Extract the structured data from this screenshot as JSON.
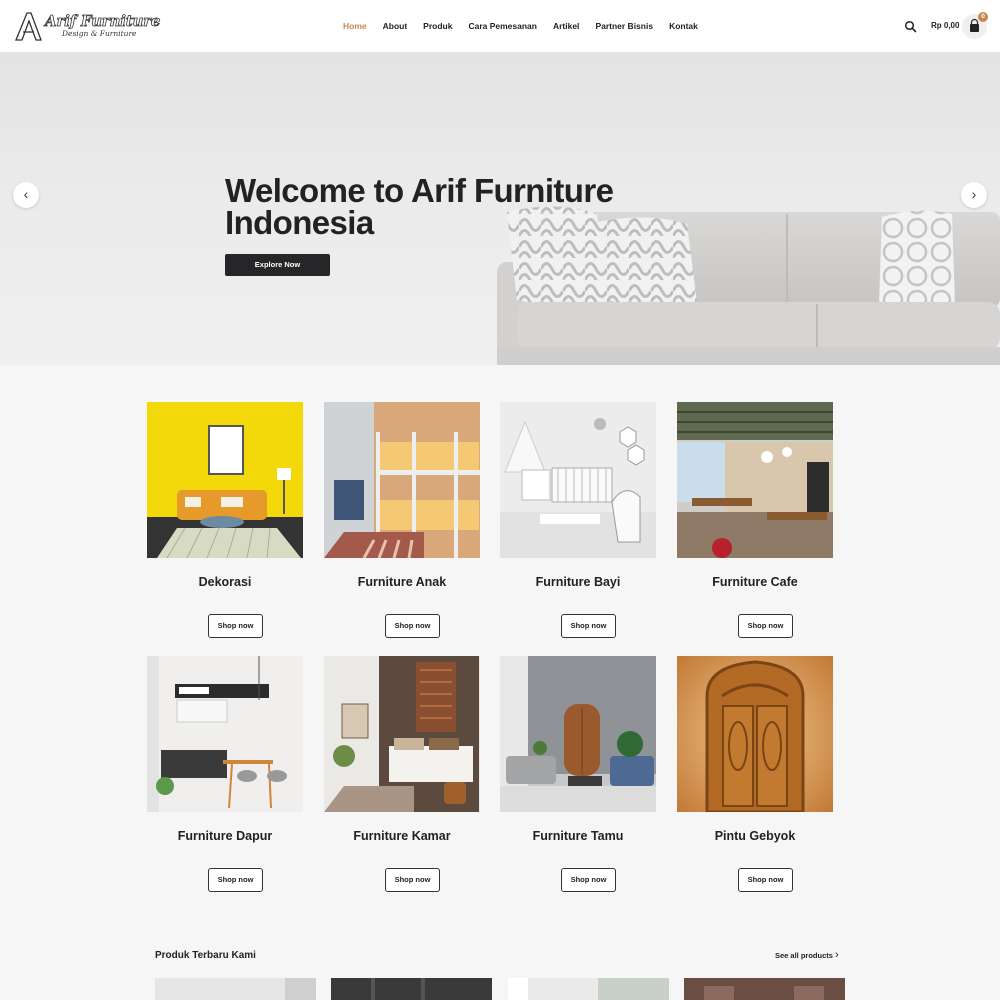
{
  "brand": {
    "name": "Arif Furniture",
    "tagline": "Design & Furniture",
    "logo_icon": "A-monogram-icon"
  },
  "nav": {
    "items": [
      {
        "label": "Home",
        "active": true
      },
      {
        "label": "About",
        "active": false
      },
      {
        "label": "Produk",
        "active": false
      },
      {
        "label": "Cara Pemesanan",
        "active": false
      },
      {
        "label": "Artikel",
        "active": false
      },
      {
        "label": "Partner Bisnis",
        "active": false
      },
      {
        "label": "Kontak",
        "active": false
      }
    ],
    "search_icon": "search-icon",
    "cart_total": "Rp 0,00",
    "cart_count": "0",
    "cart_icon": "shopping-bag-icon"
  },
  "hero": {
    "title": "Welcome to Arif Furniture Indonesia",
    "button_label": "Explore Now",
    "prev_icon": "chevron-left-icon",
    "next_icon": "chevron-right-icon",
    "prev_glyph": "‹",
    "next_glyph": "›"
  },
  "categories": [
    {
      "name": "Dekorasi",
      "button": "Shop now"
    },
    {
      "name": "Furniture Anak",
      "button": "Shop now"
    },
    {
      "name": "Furniture Bayi",
      "button": "Shop now"
    },
    {
      "name": "Furniture Cafe",
      "button": "Shop now"
    },
    {
      "name": "Furniture Dapur",
      "button": "Shop now"
    },
    {
      "name": "Furniture Kamar",
      "button": "Shop now"
    },
    {
      "name": "Furniture Tamu",
      "button": "Shop now"
    },
    {
      "name": "Pintu Gebyok",
      "button": "Shop now"
    }
  ],
  "newest": {
    "title": "Produk Terbaru Kami",
    "see_all": "See all products",
    "see_all_glyph": "›"
  },
  "colors": {
    "accent": "#c8874b",
    "dark_button": "#262628",
    "page_bg": "#f6f6f6"
  }
}
